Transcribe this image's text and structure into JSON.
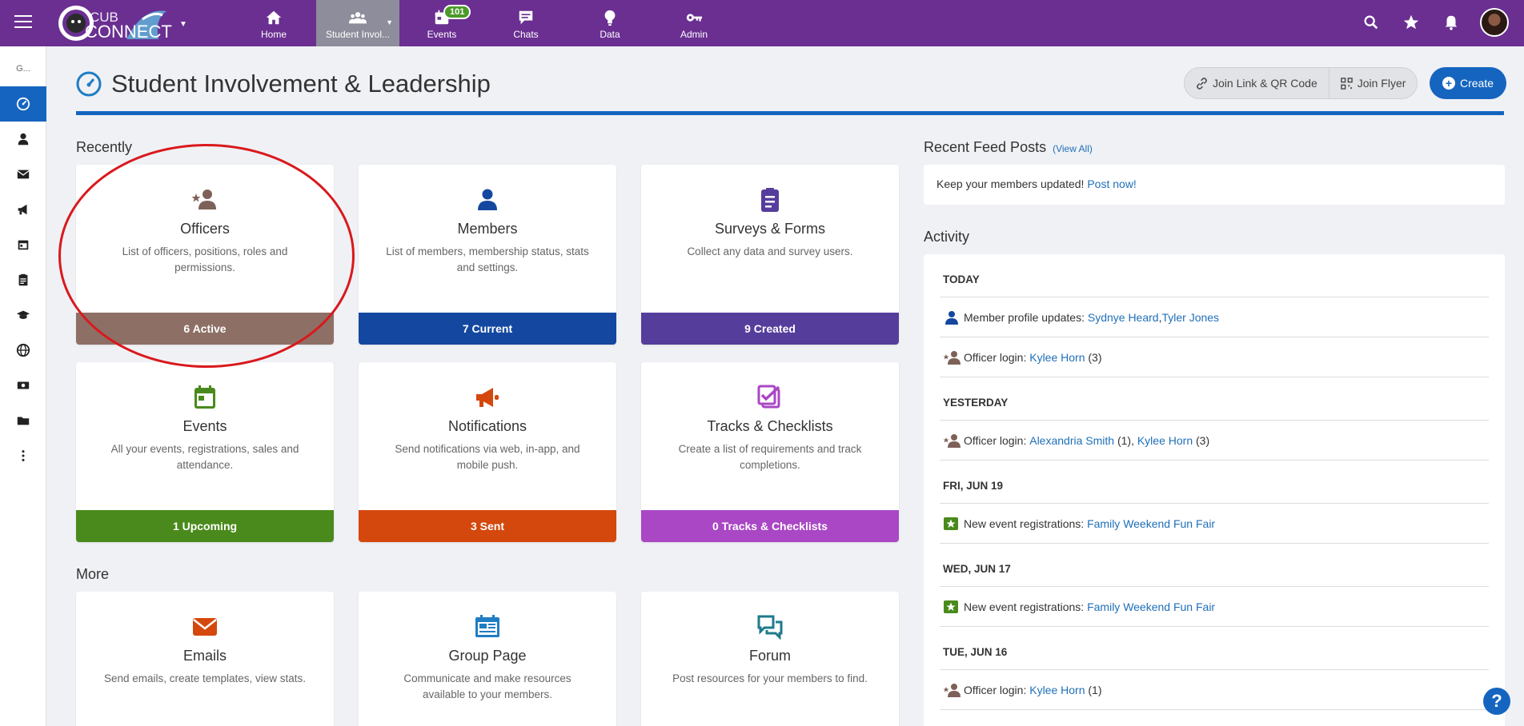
{
  "app": {
    "logo_text": "CUB CONNECT"
  },
  "nav": [
    {
      "label": "Home",
      "icon": "home-icon"
    },
    {
      "label": "Student Invol...",
      "icon": "users-icon",
      "active": true
    },
    {
      "label": "Events",
      "icon": "calendar-icon",
      "badge": "101"
    },
    {
      "label": "Chats",
      "icon": "chat-icon"
    },
    {
      "label": "Data",
      "icon": "lightbulb-icon"
    },
    {
      "label": "Admin",
      "icon": "key-icon"
    }
  ],
  "sidebar": {
    "group_abbrev": "G...",
    "items": [
      "dashboard-icon",
      "person-icon",
      "mail-icon",
      "megaphone-icon",
      "calendar-icon",
      "clipboard-icon",
      "graduation-cap-icon",
      "globe-icon",
      "money-icon",
      "folder-icon",
      "more-icon"
    ]
  },
  "header": {
    "title": "Student Involvement & Leadership",
    "join_link_label": "Join Link & QR Code",
    "join_flyer_label": "Join Flyer",
    "create_label": "Create"
  },
  "sections": {
    "recently": "Recently",
    "more": "More"
  },
  "cards": [
    {
      "title": "Officers",
      "desc": "List of officers, positions, roles and permissions.",
      "footer": "6 Active",
      "color": "#8e6f66",
      "icon": "officer-icon"
    },
    {
      "title": "Members",
      "desc": "List of members, membership status, stats and settings.",
      "footer": "7 Current",
      "color": "#1448a0",
      "icon": "member-icon"
    },
    {
      "title": "Surveys & Forms",
      "desc": "Collect any data and survey users.",
      "footer": "9 Created",
      "color": "#553d9c",
      "icon": "clipboard-list-icon"
    },
    {
      "title": "Events",
      "desc": "All your events, registrations, sales and attendance.",
      "footer": "1 Upcoming",
      "color": "#4a8a1c",
      "icon": "calendar-icon"
    },
    {
      "title": "Notifications",
      "desc": "Send notifications via web, in-app, and mobile push.",
      "footer": "3 Sent",
      "color": "#d4480e",
      "icon": "megaphone-icon"
    },
    {
      "title": "Tracks & Checklists",
      "desc": "Create a list of requirements and track completions.",
      "footer": "0 Tracks & Checklists",
      "color": "#a947c5",
      "icon": "checklist-icon"
    },
    {
      "title": "Emails",
      "desc": "Send emails, create templates, view stats.",
      "color": "#d4480e",
      "icon": "envelope-icon"
    },
    {
      "title": "Group Page",
      "desc": "Communicate and make resources available to your members.",
      "color": "#1f7dc4",
      "icon": "newspaper-icon"
    },
    {
      "title": "Forum",
      "desc": "Post resources for your members to find.",
      "color": "#1f7a8c",
      "icon": "forum-icon"
    }
  ],
  "feed": {
    "title": "Recent Feed Posts",
    "view_all": "(View All)",
    "prompt": "Keep your members updated!",
    "post_now": "Post now!"
  },
  "activity": {
    "title": "Activity",
    "groups": [
      {
        "date": "TODAY",
        "rows": [
          {
            "icon": "member-icon",
            "text": "Member profile updates:",
            "links": [
              "Sydnye Heard",
              "Tyler Jones"
            ],
            "sep": ", "
          },
          {
            "icon": "officer-icon",
            "text": "Officer login:",
            "links": [
              "Kylee Horn"
            ],
            "suffix": "(3)"
          }
        ]
      },
      {
        "date": "YESTERDAY",
        "rows": [
          {
            "icon": "officer-icon",
            "text": "Officer login:",
            "links": [
              "Alexandria Smith"
            ],
            "mid": "(1),",
            "links2": [
              "Kylee Horn"
            ],
            "suffix": "(3)"
          }
        ]
      },
      {
        "date": "FRI, JUN 19",
        "rows": [
          {
            "icon": "event-star-icon",
            "text": "New event registrations:",
            "links": [
              "Family Weekend Fun Fair"
            ]
          }
        ]
      },
      {
        "date": "WED, JUN 17",
        "rows": [
          {
            "icon": "event-star-icon",
            "text": "New event registrations:",
            "links": [
              "Family Weekend Fun Fair"
            ]
          }
        ]
      },
      {
        "date": "TUE, JUN 16",
        "rows": [
          {
            "icon": "officer-icon",
            "text": "Officer login:",
            "links": [
              "Kylee Horn"
            ],
            "suffix": "(1)"
          }
        ]
      }
    ]
  },
  "help": "?"
}
